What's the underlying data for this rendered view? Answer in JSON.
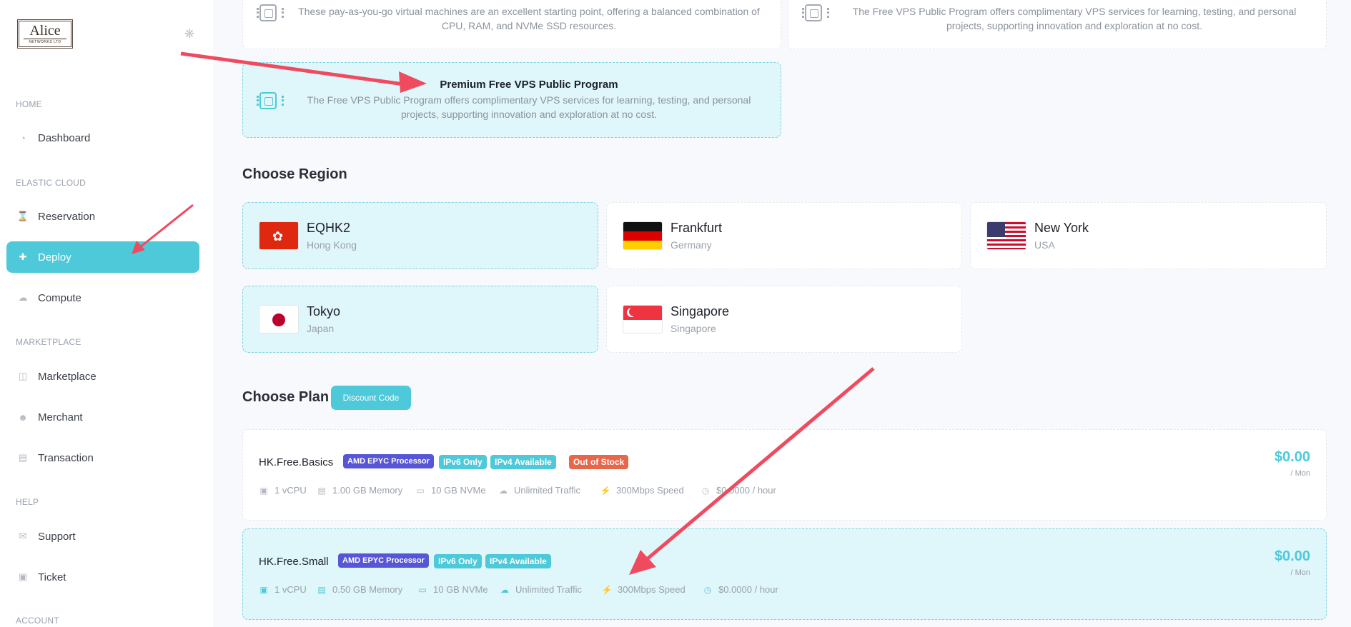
{
  "brand": {
    "logo_main": "Alice",
    "logo_sub": "NETWORKS LTD"
  },
  "sidebar": {
    "sections": {
      "home": "HOME",
      "elastic_cloud": "ELASTIC CLOUD",
      "marketplace": "MARKETPLACE",
      "help": "HELP",
      "account": "ACCOUNT"
    },
    "items": {
      "dashboard": "Dashboard",
      "reservation": "Reservation",
      "deploy": "Deploy",
      "compute": "Compute",
      "marketplace": "Marketplace",
      "merchant": "Merchant",
      "transaction": "Transaction",
      "support": "Support",
      "ticket": "Ticket"
    }
  },
  "programs": [
    {
      "desc": "These pay-as-you-go virtual machines are an excellent starting point, offering a balanced combination of CPU, RAM, and NVMe SSD resources."
    },
    {
      "desc": "The Free VPS Public Program offers complimentary VPS services for learning, testing, and personal projects, supporting innovation and exploration at no cost."
    },
    {
      "title": "Premium Free VPS Public Program",
      "desc": "The Free VPS Public Program offers complimentary VPS services for learning, testing, and personal projects, supporting innovation and exploration at no cost.",
      "selected": true
    }
  ],
  "region_heading": "Choose Region",
  "regions": [
    {
      "name": "EQHK2",
      "sub": "Hong Kong",
      "flag": "hong-kong",
      "selected": true
    },
    {
      "name": "Frankfurt",
      "sub": "Germany",
      "flag": "germany"
    },
    {
      "name": "New York",
      "sub": "USA",
      "flag": "usa"
    },
    {
      "name": "Tokyo",
      "sub": "Japan",
      "flag": "japan",
      "selected": true
    },
    {
      "name": "Singapore",
      "sub": "Singapore",
      "flag": "singapore"
    }
  ],
  "plan_heading": "Choose Plan",
  "discount_button": "Discount Code",
  "plans": [
    {
      "name": "HK.Free.Basics",
      "badges": [
        "AMD EPYC Processor",
        "IPv6 Only",
        "IPv4 Available",
        "Out of Stock"
      ],
      "specs": [
        "1 vCPU",
        "1.00 GB Memory",
        "10 GB NVMe",
        "Unlimited Traffic",
        "300Mbps Speed",
        "$0.0000 / hour"
      ],
      "price": "$0.00",
      "period": "/ Mon"
    },
    {
      "name": "HK.Free.Small",
      "badges": [
        "AMD EPYC Processor",
        "IPv6 Only",
        "IPv4 Available"
      ],
      "specs": [
        "1 vCPU",
        "0.50 GB Memory",
        "10 GB NVMe",
        "Unlimited Traffic",
        "300Mbps Speed",
        "$0.0000 / hour"
      ],
      "price": "$0.00",
      "period": "/ Mon",
      "selected": true
    }
  ],
  "colors": {
    "accent": "#4dc9d9",
    "selected_bg": "#dff6fa",
    "badge_amd": "#5656d6",
    "badge_out": "#e8664a",
    "annotation_arrow": "#f04a5f"
  }
}
